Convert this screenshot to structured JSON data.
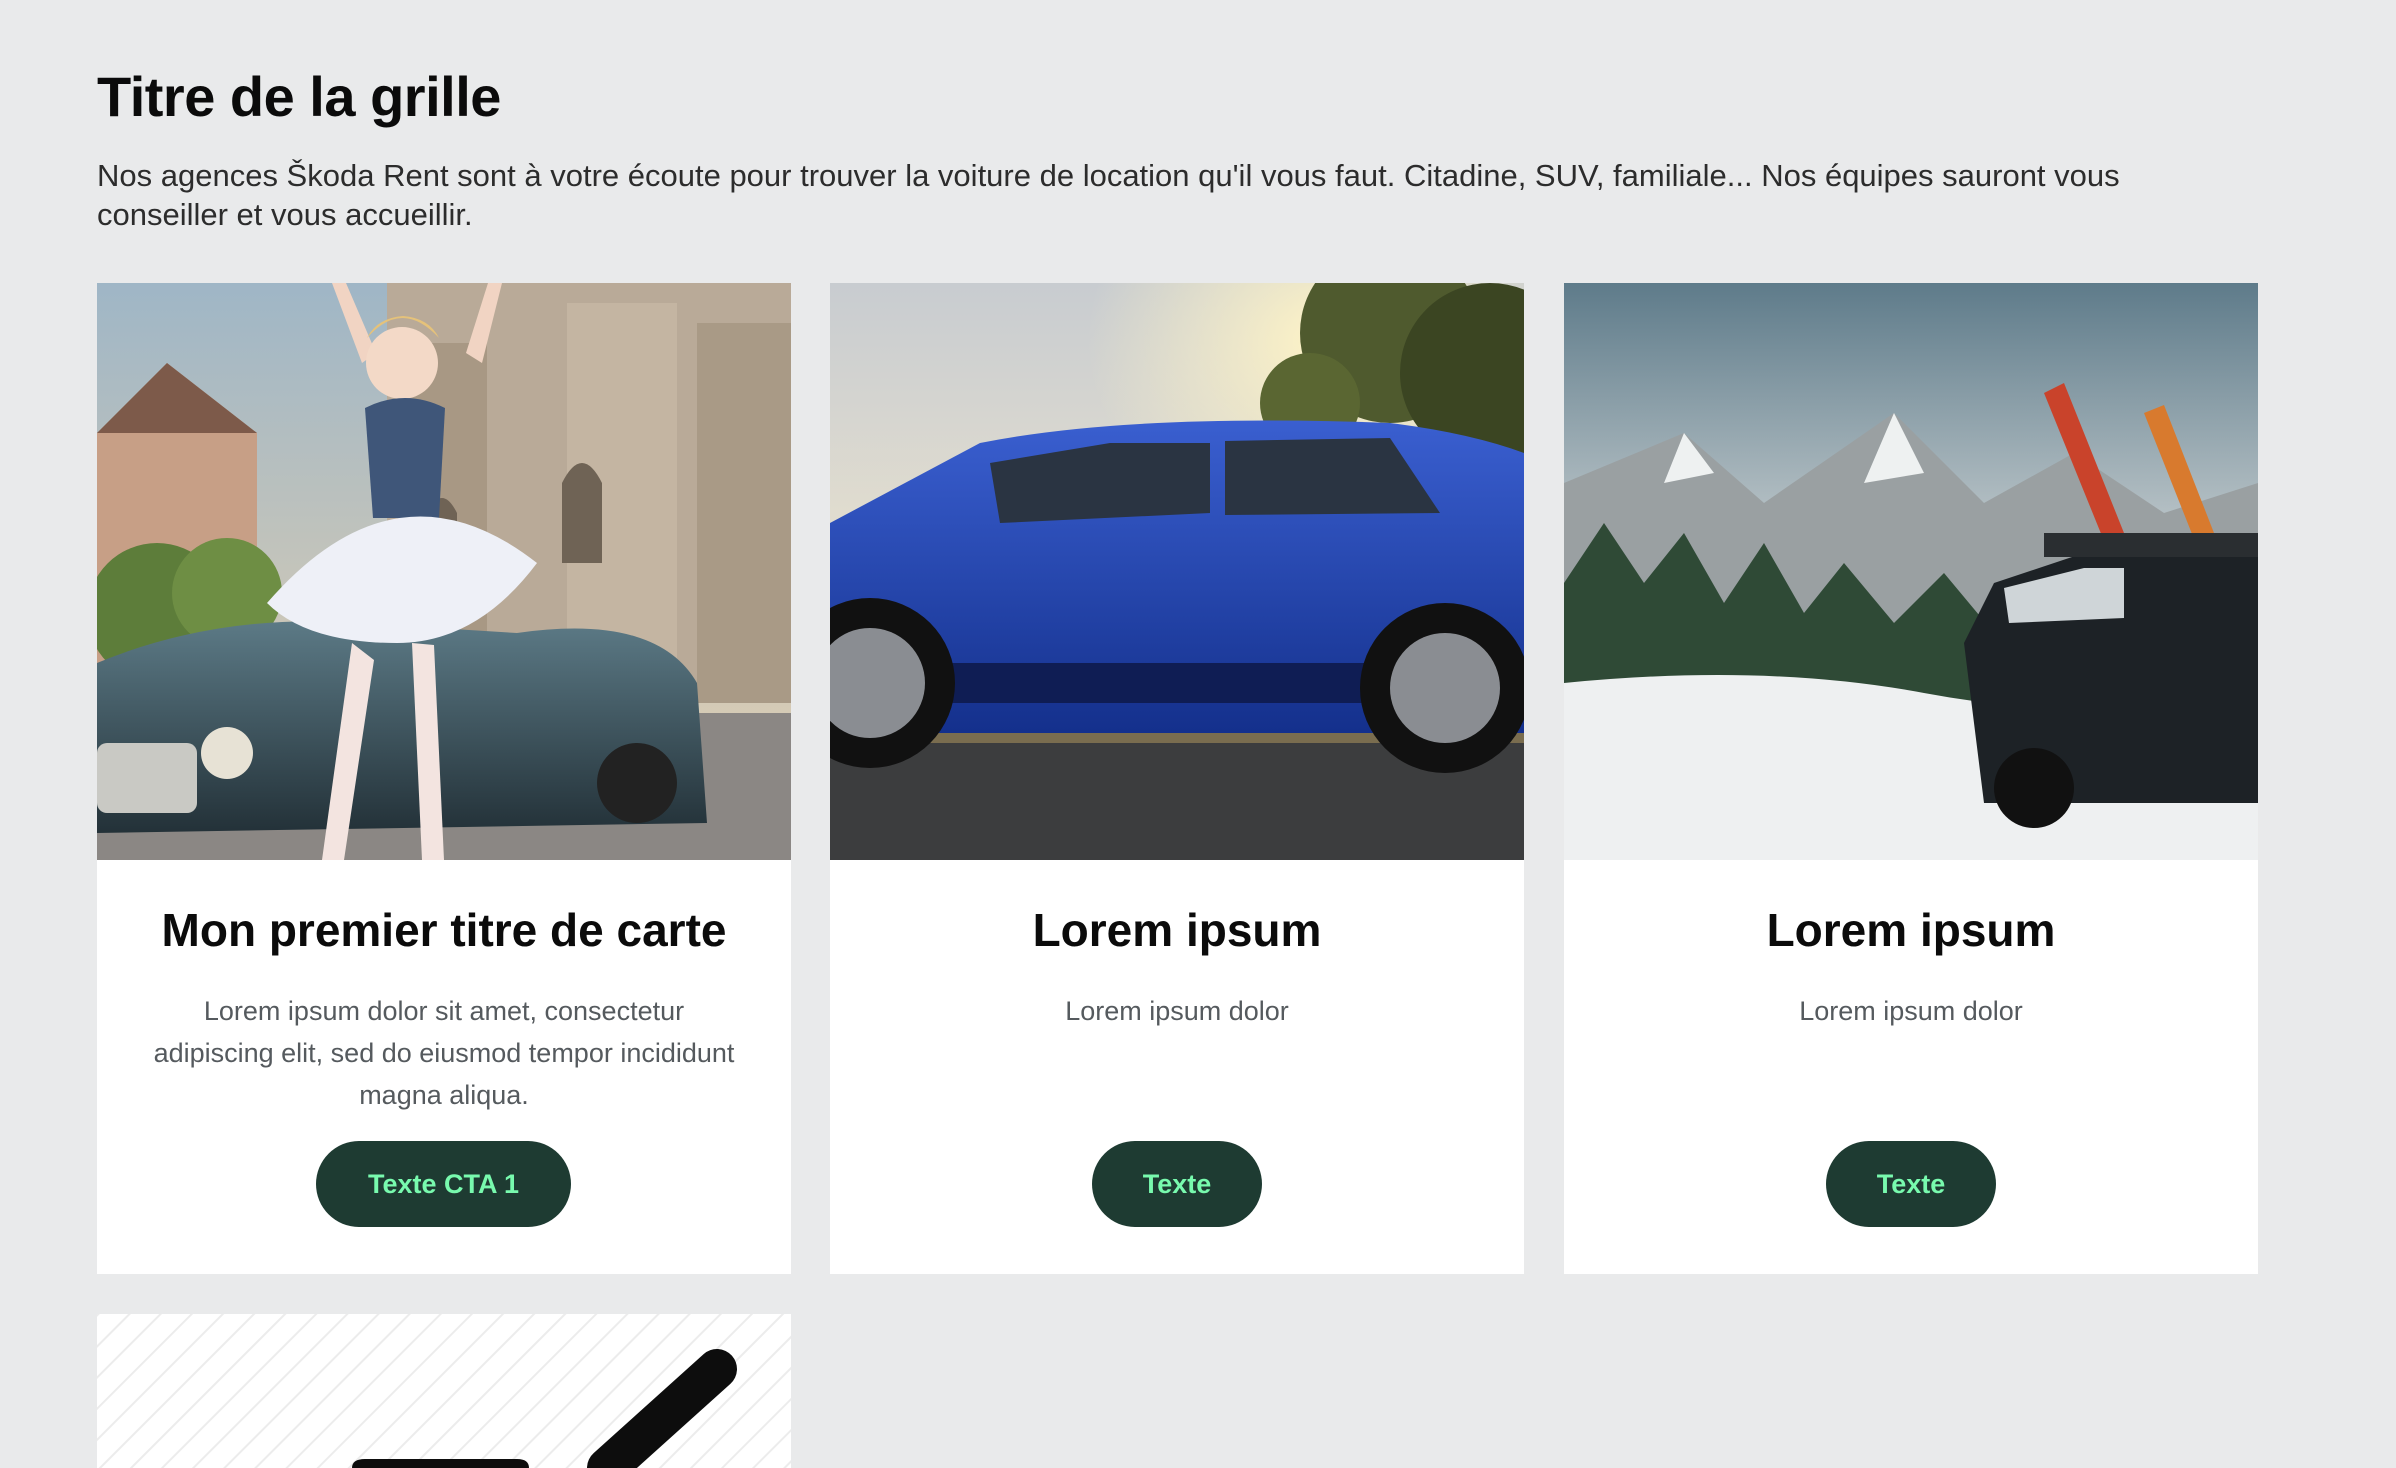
{
  "grid": {
    "title": "Titre de la grille",
    "description": "Nos agences Škoda Rent sont à votre écoute pour trouver la voiture de location qu'il vous faut. Citadine, SUV, familiale... Nos équipes sauront vous conseiller et vous accueillir."
  },
  "cards": [
    {
      "image": "ballerina-vintage-car-cathedral-photo",
      "title": "Mon premier titre de carte",
      "text": "Lorem ipsum dolor sit amet, consectetur adipiscing elit, sed do eiusmod tempor incididunt magna aliqua.",
      "cta": "Texte CTA 1"
    },
    {
      "image": "blue-suv-sunset-photo",
      "title": "Lorem ipsum",
      "text": "Lorem ipsum dolor",
      "cta": "Texte"
    },
    {
      "image": "suv-with-skis-snowy-mountains-photo",
      "title": "Lorem ipsum",
      "text": "Lorem ipsum dolor",
      "cta": "Texte"
    },
    {
      "image": "placeholder-illustration"
    }
  ],
  "colors": {
    "page_bg": "#e9eaeb",
    "card_bg": "#ffffff",
    "cta_bg": "#1e3b32",
    "cta_text": "#78faae",
    "title_text": "#0b0b0b",
    "body_text": "#555a5e"
  }
}
